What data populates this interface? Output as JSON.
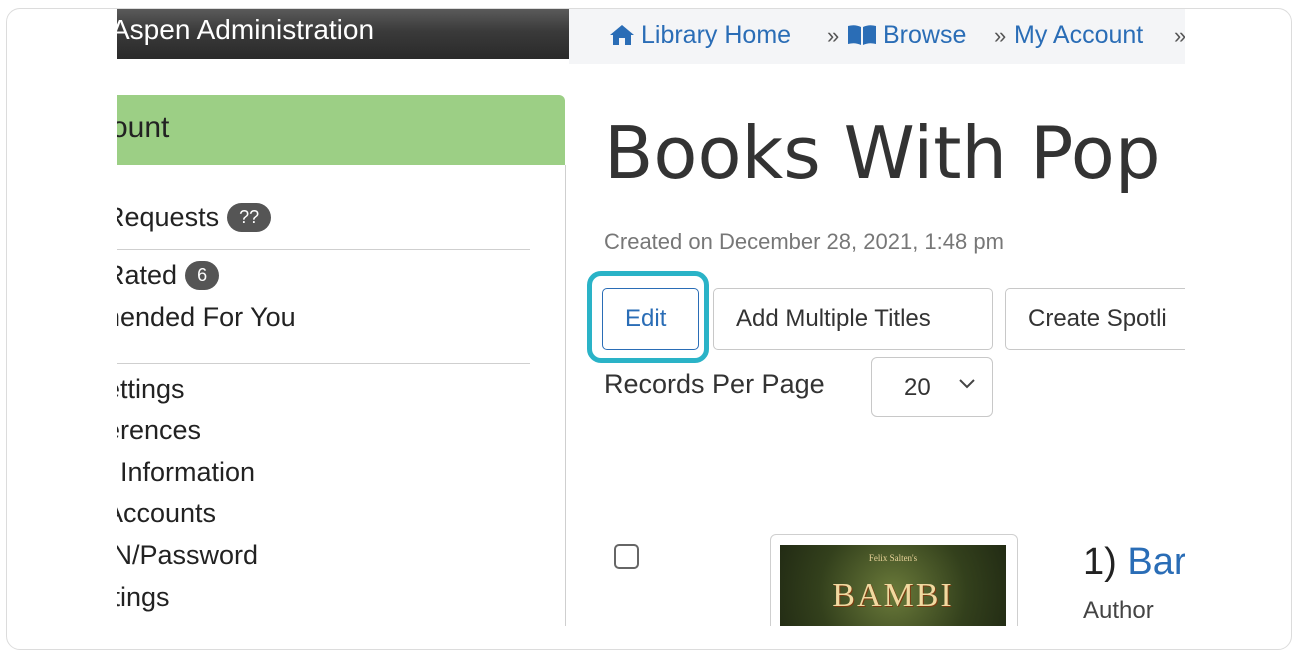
{
  "admin_bar": {
    "title": "Aspen Administration"
  },
  "breadcrumb": {
    "items": [
      {
        "label": "Library Home",
        "icon": "home-icon"
      },
      {
        "label": "Browse",
        "icon": "book-icon"
      },
      {
        "label": "My Account"
      }
    ],
    "separator": "»"
  },
  "sidebar": {
    "header": "ount",
    "items": [
      {
        "label": "Requests",
        "badge": "??"
      },
      {
        "label": "Rated",
        "badge": "6"
      },
      {
        "label": "nended For You"
      },
      {
        "label": "ettings"
      },
      {
        "label": "erences"
      },
      {
        "label": ": Information"
      },
      {
        "label": "Accounts"
      },
      {
        "label": "IN/Password"
      },
      {
        "label": "ttings"
      }
    ]
  },
  "main": {
    "title": "Books With Pop",
    "created": "Created on December 28, 2021, 1:48 pm",
    "buttons": {
      "edit": "Edit",
      "add_multiple": "Add Multiple Titles",
      "create_spotlight": "Create Spotli"
    },
    "records_per_page": {
      "label": "Records Per Page",
      "value": "20"
    },
    "results": [
      {
        "number": "1)",
        "title": "Bar",
        "author_label": "Author",
        "cover_text": "BAMBI",
        "cover_author": "Felix Salten's"
      }
    ]
  },
  "colors": {
    "link": "#2a6db6",
    "highlight": "#2ab3c7",
    "sidebar_header": "#9ccf85"
  }
}
